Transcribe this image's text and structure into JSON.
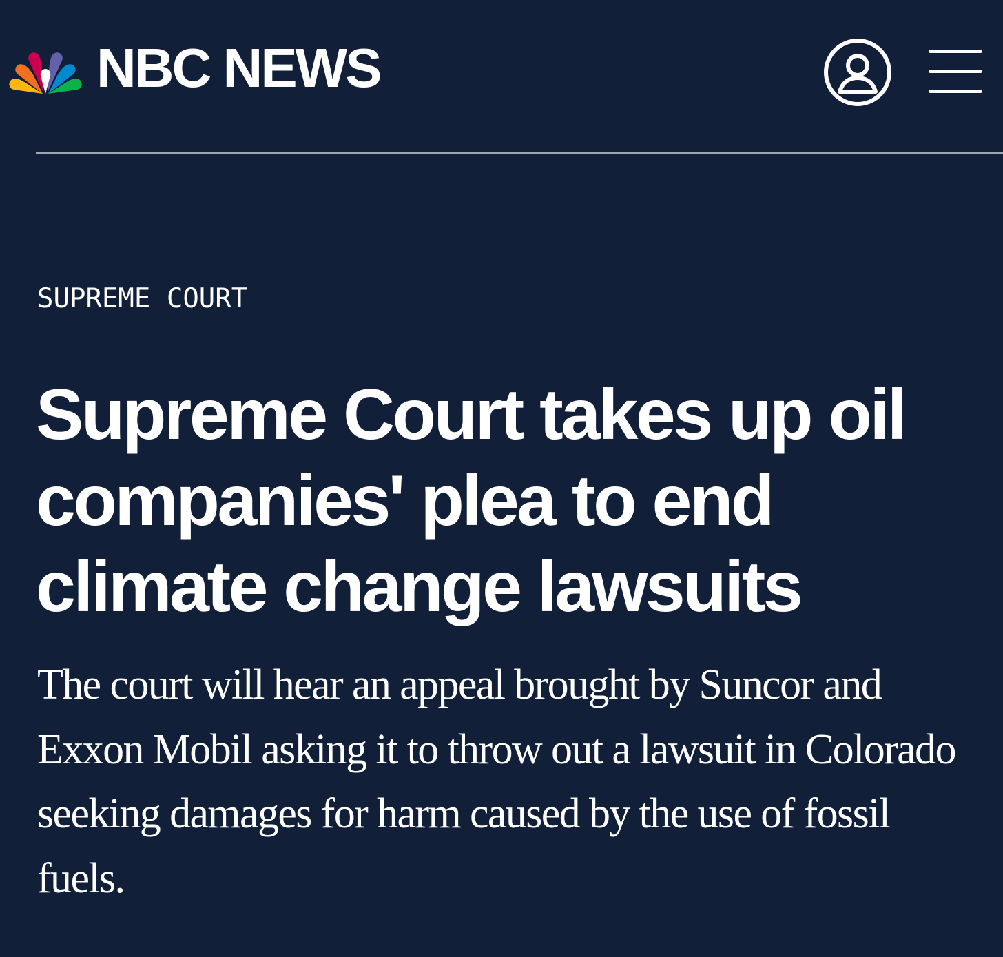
{
  "header": {
    "brand": "NBC NEWS",
    "logo_icon": "nbc-peacock-icon",
    "account_icon": "user-circle-icon",
    "menu_icon": "hamburger-menu-icon",
    "peacock_colors": [
      "#fcb711",
      "#f37021",
      "#cc004c",
      "#6460aa",
      "#0089d0",
      "#0db14b"
    ]
  },
  "article": {
    "section_label": "SUPREME COURT",
    "headline": "Supreme Court takes up oil companies' plea to end climate change lawsuits",
    "dek": "The court will hear an appeal brought by Suncor and Exxon Mobil asking it to throw out a lawsuit in Colorado seeking damages for harm caused by the use of fossil fuels."
  },
  "colors": {
    "background": "#111f39",
    "text": "#ffffff",
    "divider": "#9ea6b4"
  }
}
